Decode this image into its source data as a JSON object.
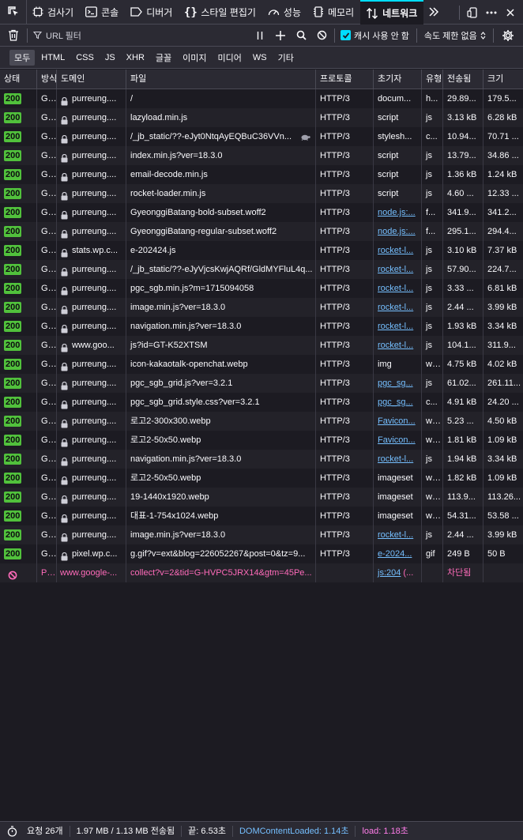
{
  "toolbar": {
    "tabs": [
      {
        "label": "검사기",
        "icon": "inspector-icon"
      },
      {
        "label": "콘솔",
        "icon": "console-icon"
      },
      {
        "label": "디버거",
        "icon": "debugger-icon"
      },
      {
        "label": "스타일 편집기",
        "icon": "style-editor-icon"
      },
      {
        "label": "성능",
        "icon": "performance-icon"
      },
      {
        "label": "메모리",
        "icon": "memory-icon"
      },
      {
        "label": "네트워크",
        "icon": "network-icon",
        "selected": true
      }
    ]
  },
  "filter": {
    "url_placeholder": "URL 필터",
    "cache_label": "캐시 사용 안 함",
    "cache_checked": true,
    "throttle_label": "속도 제한 없음"
  },
  "types": [
    "모두",
    "HTML",
    "CSS",
    "JS",
    "XHR",
    "글꼴",
    "이미지",
    "미디어",
    "WS",
    "기타"
  ],
  "active_type": "모두",
  "columns": {
    "status": "상태",
    "method": "방식",
    "domain": "도메인",
    "file": "파일",
    "protocol": "프로토콜",
    "initiator": "초기자",
    "type": "유형",
    "transferred": "전송됨",
    "size": "크기"
  },
  "requests": [
    {
      "status": "200",
      "method": "GET",
      "domain": "purreung....",
      "file": "/",
      "protocol": "HTTP/3",
      "initiator": "docum...",
      "initiator_link": false,
      "type": "h...",
      "transferred": "29.89...",
      "size": "179.5..."
    },
    {
      "status": "200",
      "method": "GET",
      "domain": "purreung....",
      "file": "lazyload.min.js",
      "protocol": "HTTP/3",
      "initiator": "script",
      "initiator_link": false,
      "type": "js",
      "transferred": "3.13 kB",
      "size": "6.28 kB"
    },
    {
      "status": "200",
      "method": "GET",
      "domain": "purreung....",
      "file": "/_jb_static/??-eJyt0NtqAyEQBuC36VVn...",
      "protocol": "HTTP/3",
      "initiator": "stylesh...",
      "initiator_link": false,
      "type": "c...",
      "transferred": "10.94...",
      "size": "70.71 ...",
      "turtle": true
    },
    {
      "status": "200",
      "method": "GET",
      "domain": "purreung....",
      "file": "index.min.js?ver=18.3.0",
      "protocol": "HTTP/3",
      "initiator": "script",
      "initiator_link": false,
      "type": "js",
      "transferred": "13.79...",
      "size": "34.86 ..."
    },
    {
      "status": "200",
      "method": "GET",
      "domain": "purreung....",
      "file": "email-decode.min.js",
      "protocol": "HTTP/3",
      "initiator": "script",
      "initiator_link": false,
      "type": "js",
      "transferred": "1.36 kB",
      "size": "1.24 kB"
    },
    {
      "status": "200",
      "method": "GET",
      "domain": "purreung....",
      "file": "rocket-loader.min.js",
      "protocol": "HTTP/3",
      "initiator": "script",
      "initiator_link": false,
      "type": "js",
      "transferred": "4.60 ...",
      "size": "12.33 ..."
    },
    {
      "status": "200",
      "method": "GET",
      "domain": "purreung....",
      "file": "GyeonggiBatang-bold-subset.woff2",
      "protocol": "HTTP/3",
      "initiator": "node.js:...",
      "initiator_link": true,
      "type": "f...",
      "transferred": "341.9...",
      "size": "341.2..."
    },
    {
      "status": "200",
      "method": "GET",
      "domain": "purreung....",
      "file": "GyeonggiBatang-regular-subset.woff2",
      "protocol": "HTTP/3",
      "initiator": "node.js:...",
      "initiator_link": true,
      "type": "f...",
      "transferred": "295.1...",
      "size": "294.4..."
    },
    {
      "status": "200",
      "method": "GET",
      "domain": "stats.wp.c...",
      "file": "e-202424.js",
      "protocol": "HTTP/3",
      "initiator": "rocket-l...",
      "initiator_link": true,
      "type": "js",
      "transferred": "3.10 kB",
      "size": "7.37 kB"
    },
    {
      "status": "200",
      "method": "GET",
      "domain": "purreung....",
      "file": "/_jb_static/??-eJyVjcsKwjAQRf/GldMYFluL4q...",
      "protocol": "HTTP/3",
      "initiator": "rocket-l...",
      "initiator_link": true,
      "type": "js",
      "transferred": "57.90...",
      "size": "224.7..."
    },
    {
      "status": "200",
      "method": "GET",
      "domain": "purreung....",
      "file": "pgc_sgb.min.js?m=1715094058",
      "protocol": "HTTP/3",
      "initiator": "rocket-l...",
      "initiator_link": true,
      "type": "js",
      "transferred": "3.33 ...",
      "size": "6.81 kB"
    },
    {
      "status": "200",
      "method": "GET",
      "domain": "purreung....",
      "file": "image.min.js?ver=18.3.0",
      "protocol": "HTTP/3",
      "initiator": "rocket-l...",
      "initiator_link": true,
      "type": "js",
      "transferred": "2.44 ...",
      "size": "3.99 kB"
    },
    {
      "status": "200",
      "method": "GET",
      "domain": "purreung....",
      "file": "navigation.min.js?ver=18.3.0",
      "protocol": "HTTP/3",
      "initiator": "rocket-l...",
      "initiator_link": true,
      "type": "js",
      "transferred": "1.93 kB",
      "size": "3.34 kB"
    },
    {
      "status": "200",
      "method": "GET",
      "domain": "www.goo...",
      "file": "js?id=GT-K52XTSM",
      "protocol": "HTTP/3",
      "initiator": "rocket-l...",
      "initiator_link": true,
      "type": "js",
      "transferred": "104.1...",
      "size": "311.9..."
    },
    {
      "status": "200",
      "method": "GET",
      "domain": "purreung....",
      "file": "icon-kakaotalk-openchat.webp",
      "protocol": "HTTP/3",
      "initiator": "img",
      "initiator_link": false,
      "type": "webp",
      "transferred": "4.75 kB",
      "size": "4.02 kB"
    },
    {
      "status": "200",
      "method": "GET",
      "domain": "purreung....",
      "file": "pgc_sgb_grid.js?ver=3.2.1",
      "protocol": "HTTP/3",
      "initiator": "pgc_sg...",
      "initiator_link": true,
      "type": "js",
      "transferred": "61.02...",
      "size": "261.11..."
    },
    {
      "status": "200",
      "method": "GET",
      "domain": "purreung....",
      "file": "pgc_sgb_grid.style.css?ver=3.2.1",
      "protocol": "HTTP/3",
      "initiator": "pgc_sg...",
      "initiator_link": true,
      "type": "c...",
      "transferred": "4.91 kB",
      "size": "24.20 ..."
    },
    {
      "status": "200",
      "method": "GET",
      "domain": "purreung....",
      "file": "로고2-300x300.webp",
      "protocol": "HTTP/3",
      "initiator": "Favicon...",
      "initiator_link": true,
      "type": "webp",
      "transferred": "5.23 ...",
      "size": "4.50 kB"
    },
    {
      "status": "200",
      "method": "GET",
      "domain": "purreung....",
      "file": "로고2-50x50.webp",
      "protocol": "HTTP/3",
      "initiator": "Favicon...",
      "initiator_link": true,
      "type": "webp",
      "transferred": "1.81 kB",
      "size": "1.09 kB"
    },
    {
      "status": "200",
      "method": "GET",
      "domain": "purreung....",
      "file": "navigation.min.js?ver=18.3.0",
      "protocol": "HTTP/3",
      "initiator": "rocket-l...",
      "initiator_link": true,
      "type": "js",
      "transferred": "1.94 kB",
      "size": "3.34 kB"
    },
    {
      "status": "200",
      "method": "GET",
      "domain": "purreung....",
      "file": "로고2-50x50.webp",
      "protocol": "HTTP/3",
      "initiator": "imageset",
      "initiator_link": false,
      "type": "webp",
      "transferred": "1.82 kB",
      "size": "1.09 kB"
    },
    {
      "status": "200",
      "method": "GET",
      "domain": "purreung....",
      "file": "19-1440x1920.webp",
      "protocol": "HTTP/3",
      "initiator": "imageset",
      "initiator_link": false,
      "type": "webp",
      "transferred": "113.9...",
      "size": "113.26..."
    },
    {
      "status": "200",
      "method": "GET",
      "domain": "purreung....",
      "file": "대표-1-754x1024.webp",
      "protocol": "HTTP/3",
      "initiator": "imageset",
      "initiator_link": false,
      "type": "webp",
      "transferred": "54.31...",
      "size": "53.58 ..."
    },
    {
      "status": "200",
      "method": "GET",
      "domain": "purreung....",
      "file": "image.min.js?ver=18.3.0",
      "protocol": "HTTP/3",
      "initiator": "rocket-l...",
      "initiator_link": true,
      "type": "js",
      "transferred": "2.44 ...",
      "size": "3.99 kB"
    },
    {
      "status": "200",
      "method": "GET",
      "domain": "pixel.wp.c...",
      "file": "g.gif?v=ext&blog=226052267&post=0&tz=9...",
      "protocol": "HTTP/3",
      "initiator": "e-2024...",
      "initiator_link": true,
      "type": "gif",
      "transferred": "249 B",
      "size": "50 B"
    },
    {
      "status": "",
      "method": "POST",
      "domain": "www.google-...",
      "file": "collect?v=2&tid=G-HVPC5JRX14&gtm=45Pe...",
      "protocol": "",
      "initiator": "js:204",
      "initiator_extra": " (...",
      "initiator_link": true,
      "type": "",
      "transferred": "차단됨",
      "size": "",
      "blocked": true
    }
  ],
  "statusbar": {
    "requests": "요청 26개",
    "transferred": "1.97 MB / 1.13 MB 전송됨",
    "finish": "끝: 6.53초",
    "dom_content_loaded": "DOMContentLoaded: 1.14초",
    "load": "load: 1.18초"
  },
  "colors": {
    "status_ok": "#51c13c",
    "link": "#75bfff",
    "blocked": "#ff6bba",
    "accent": "#00ddff"
  }
}
